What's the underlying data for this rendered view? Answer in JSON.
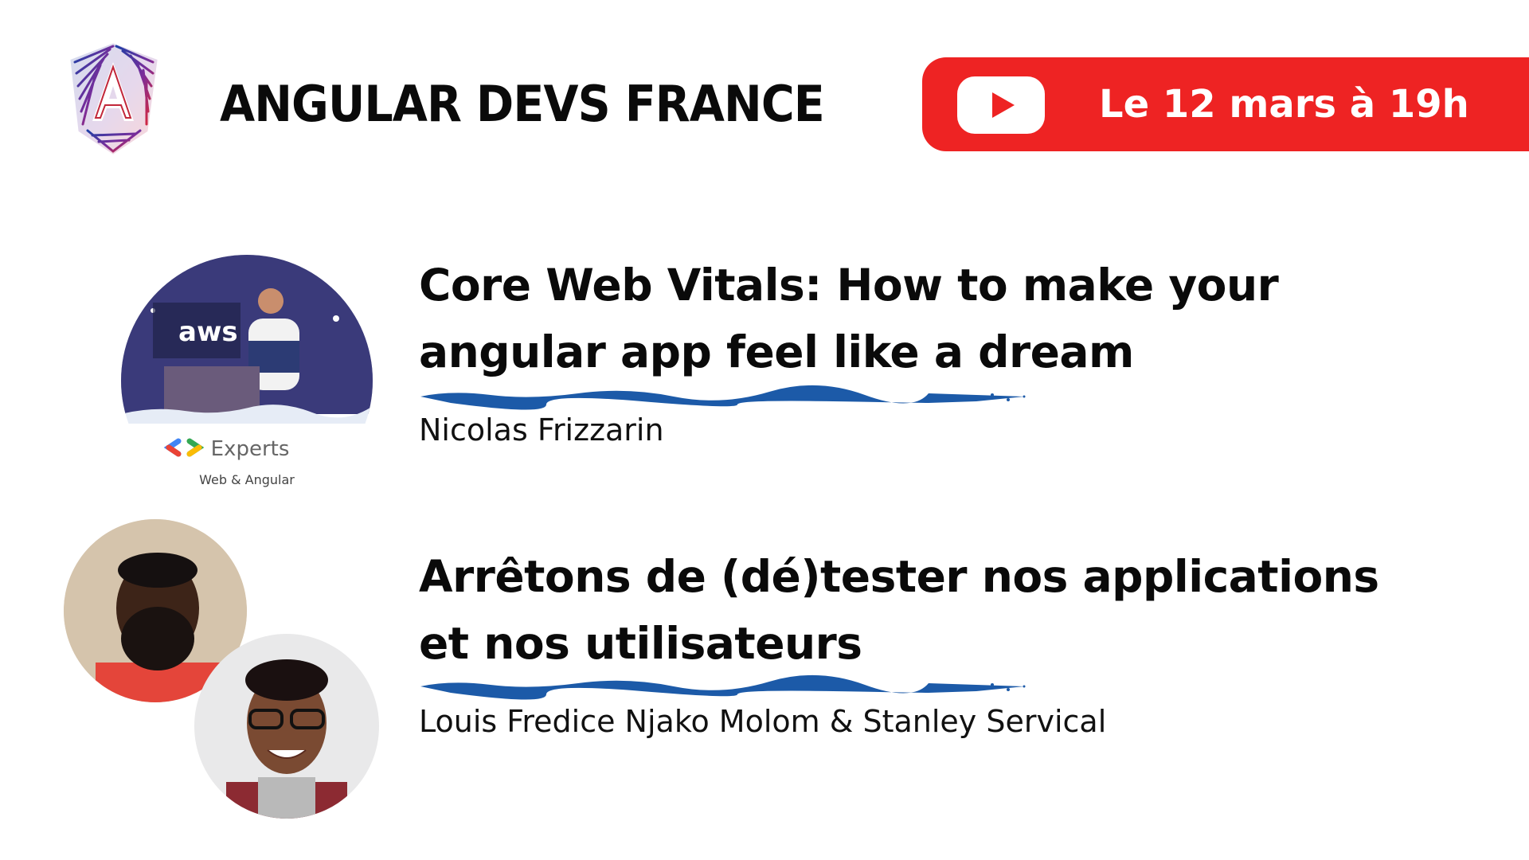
{
  "header": {
    "title": "ANGULAR DEVS FRANCE",
    "logo_icon": "angular-logo-icon",
    "live": {
      "icon": "youtube-play-icon",
      "date": "Le 12 mars à 19h"
    }
  },
  "colors": {
    "live_red": "#ee2323",
    "brush_blue": "#1c5aa8",
    "text": "#0a0a0a"
  },
  "talks": [
    {
      "title_line1": "Core Web Vitals: How to make your",
      "title_line2": "angular app feel like a dream",
      "speaker": "Nicolas Frizzarin",
      "photo": {
        "banner_text": "aws",
        "badge_title": "Experts",
        "badge_subtitle": "Web & Angular"
      }
    },
    {
      "title_line1": "Arrêtons de (dé)tester nos applications",
      "title_line2": "et nos utilisateurs",
      "speaker": "Louis Fredice Njako Molom & Stanley Servical"
    }
  ]
}
